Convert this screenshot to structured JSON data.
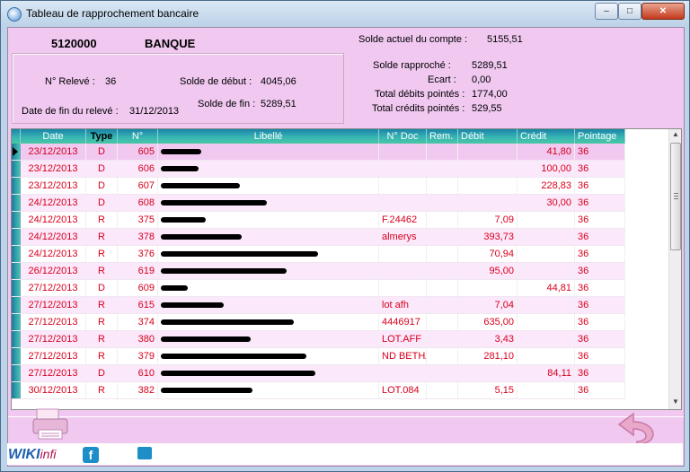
{
  "window": {
    "title": "Tableau de rapprochement bancaire",
    "min": "–",
    "max": "□",
    "close": "✕"
  },
  "account": {
    "number": "5120000",
    "name": "BANQUE"
  },
  "statement": {
    "releve_label": "N° Relevé :",
    "releve_value": "36",
    "date_fin_label": "Date de fin du relevé :",
    "date_fin_value": "31/12/2013",
    "solde_debut_label": "Solde de début :",
    "solde_debut_value": "4045,06",
    "solde_fin_label": "Solde de fin :",
    "solde_fin_value": "5289,51"
  },
  "summary": {
    "solde_actuel_label": "Solde actuel du compte :",
    "solde_actuel_value": "5155,51",
    "solde_rapproche_label": "Solde rapproché :",
    "solde_rapproche_value": "5289,51",
    "ecart_label": "Ecart :",
    "ecart_value": "0,00",
    "total_debits_label": "Total débits pointés :",
    "total_debits_value": "1774,00",
    "total_credits_label": "Total crédits pointés :",
    "total_credits_value": "529,55"
  },
  "table": {
    "columns": {
      "date": "Date",
      "type": "Type",
      "num": "N°",
      "libelle": "Libellé",
      "doc": "N° Doc",
      "rem": "Rem.",
      "debit": "Débit",
      "credit": "Crédit",
      "pointage": "Pointage"
    },
    "rows": [
      {
        "date": "23/12/2013",
        "type": "D",
        "num": "605",
        "doc": "",
        "rem": "",
        "debit": "",
        "credit": "41,80",
        "pointage": "36"
      },
      {
        "date": "23/12/2013",
        "type": "D",
        "num": "606",
        "doc": "",
        "rem": "",
        "debit": "",
        "credit": "100,00",
        "pointage": "36"
      },
      {
        "date": "23/12/2013",
        "type": "D",
        "num": "607",
        "doc": "",
        "rem": "",
        "debit": "",
        "credit": "228,83",
        "pointage": "36"
      },
      {
        "date": "24/12/2013",
        "type": "D",
        "num": "608",
        "doc": "",
        "rem": "",
        "debit": "",
        "credit": "30,00",
        "pointage": "36"
      },
      {
        "date": "24/12/2013",
        "type": "R",
        "num": "375",
        "doc": "F.24462",
        "rem": "",
        "debit": "7,09",
        "credit": "",
        "pointage": "36"
      },
      {
        "date": "24/12/2013",
        "type": "R",
        "num": "378",
        "doc": "almerys",
        "rem": "",
        "debit": "393,73",
        "credit": "",
        "pointage": "36"
      },
      {
        "date": "24/12/2013",
        "type": "R",
        "num": "376",
        "doc": "",
        "rem": "",
        "debit": "70,94",
        "credit": "",
        "pointage": "36"
      },
      {
        "date": "26/12/2013",
        "type": "R",
        "num": "619",
        "doc": "",
        "rem": "",
        "debit": "95,00",
        "credit": "",
        "pointage": "36"
      },
      {
        "date": "27/12/2013",
        "type": "D",
        "num": "609",
        "doc": "",
        "rem": "",
        "debit": "",
        "credit": "44,81",
        "pointage": "36"
      },
      {
        "date": "27/12/2013",
        "type": "R",
        "num": "615",
        "doc": "lot afh",
        "rem": "",
        "debit": "7,04",
        "credit": "",
        "pointage": "36"
      },
      {
        "date": "27/12/2013",
        "type": "R",
        "num": "374",
        "doc": "4446917",
        "rem": "",
        "debit": "635,00",
        "credit": "",
        "pointage": "36"
      },
      {
        "date": "27/12/2013",
        "type": "R",
        "num": "380",
        "doc": "LOT.AFF",
        "rem": "",
        "debit": "3,43",
        "credit": "",
        "pointage": "36"
      },
      {
        "date": "27/12/2013",
        "type": "R",
        "num": "379",
        "doc": "ND BETHA",
        "rem": "",
        "debit": "281,10",
        "credit": "",
        "pointage": "36"
      },
      {
        "date": "27/12/2013",
        "type": "D",
        "num": "610",
        "doc": "",
        "rem": "",
        "debit": "",
        "credit": "84,11",
        "pointage": "36"
      },
      {
        "date": "30/12/2013",
        "type": "R",
        "num": "382",
        "doc": "LOT.084",
        "rem": "",
        "debit": "5,15",
        "credit": "",
        "pointage": "36"
      }
    ]
  },
  "footer": {
    "wiki": "WIKI",
    "wiki_suffix": "infi"
  },
  "colors": {
    "client_bg": "#f0c8f0",
    "header_grad": "#37b5b4",
    "row_text": "#d8001c"
  }
}
